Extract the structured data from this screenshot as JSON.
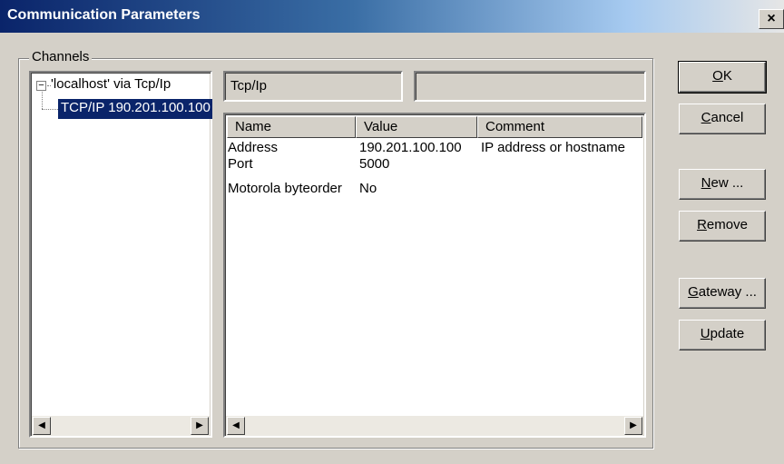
{
  "window": {
    "title": "Communication Parameters",
    "close_glyph": "×"
  },
  "channels": {
    "group_label": "Channels",
    "tree": {
      "root_label": "'localhost' via Tcp/Ip",
      "root_expander": "−",
      "child_label": "TCP/IP 190.201.100.100"
    }
  },
  "driver": {
    "name": "Tcp/Ip",
    "info": ""
  },
  "table": {
    "columns": [
      "Name",
      "Value",
      "Comment"
    ],
    "rows": [
      {
        "name": "Address",
        "value": "190.201.100.100",
        "comment": "IP address or hostname"
      },
      {
        "name": "Port",
        "value": "5000",
        "comment": ""
      },
      {
        "name": "Motorola byteorder",
        "value": "No",
        "comment": ""
      }
    ]
  },
  "scroll": {
    "left_glyph": "◀",
    "right_glyph": "▶"
  },
  "buttons": {
    "ok": {
      "mnemonic": "O",
      "rest": "K"
    },
    "cancel": {
      "mnemonic": "C",
      "rest": "ancel"
    },
    "new": {
      "mnemonic": "N",
      "rest": "ew ..."
    },
    "remove": {
      "mnemonic": "R",
      "rest": "emove"
    },
    "gateway": {
      "mnemonic": "G",
      "rest": "ateway ..."
    },
    "update": {
      "mnemonic": "U",
      "rest": "pdate"
    }
  }
}
